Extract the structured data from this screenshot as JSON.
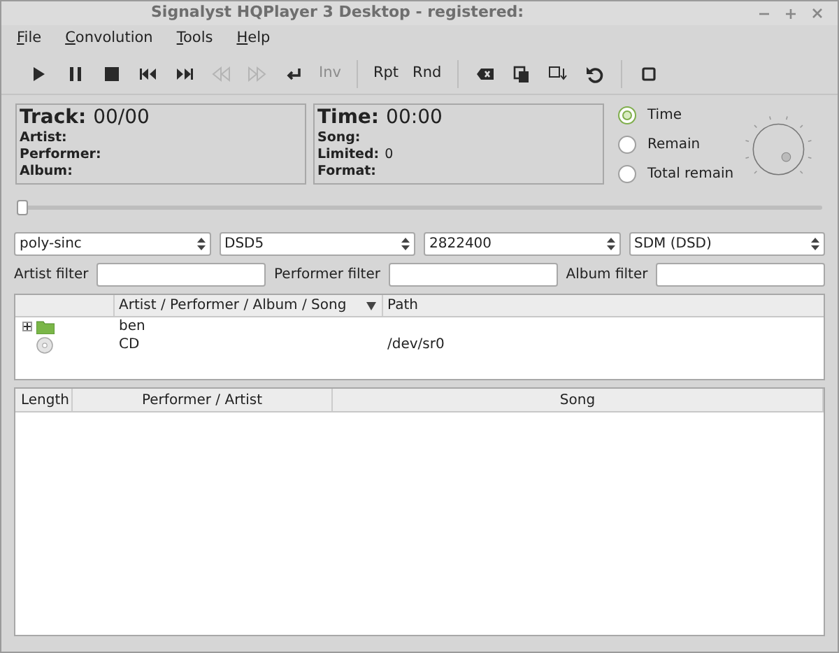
{
  "window": {
    "title": "Signalyst HQPlayer 3 Desktop - registered:"
  },
  "menu": [
    {
      "label": "File"
    },
    {
      "label": "Convolution"
    },
    {
      "label": "Tools"
    },
    {
      "label": "Help"
    }
  ],
  "toolbar": [
    {
      "kind": "icon",
      "disabled": false
    },
    {
      "kind": "icon",
      "disabled": false
    },
    {
      "kind": "icon",
      "disabled": false
    },
    {
      "kind": "icon",
      "disabled": false
    },
    {
      "kind": "icon",
      "disabled": false
    },
    {
      "kind": "icon",
      "disabled": true
    },
    {
      "kind": "icon",
      "disabled": true
    },
    {
      "kind": "icon",
      "disabled": false
    },
    {
      "kind": "text",
      "label": "Inv",
      "disabled": true
    },
    {
      "kind": "separator"
    },
    {
      "kind": "text",
      "label": "Rpt",
      "disabled": false
    },
    {
      "kind": "text",
      "label": "Rnd",
      "disabled": false
    },
    {
      "kind": "separator"
    },
    {
      "kind": "icon",
      "disabled": false
    },
    {
      "kind": "icon",
      "disabled": false
    },
    {
      "kind": "icon",
      "disabled": false
    },
    {
      "kind": "icon",
      "disabled": false
    },
    {
      "kind": "separator"
    },
    {
      "kind": "icon",
      "disabled": false
    }
  ],
  "track_panel": {
    "heading": "Track:",
    "value": "00/00",
    "fields": [
      {
        "label": "Artist:"
      },
      {
        "label": "Performer:"
      },
      {
        "label": "Album:"
      }
    ]
  },
  "time_panel": {
    "heading": "Time:",
    "value": "00:00",
    "fields": [
      {
        "label": "Song:"
      },
      {
        "label": "Limited:",
        "value": "0"
      },
      {
        "label": "Format:"
      }
    ]
  },
  "time_mode": [
    {
      "label": "Time",
      "selected": true
    },
    {
      "label": "Remain",
      "selected": false
    },
    {
      "label": "Total remain",
      "selected": false
    }
  ],
  "seek": {
    "level": 0
  },
  "selectors": [
    {
      "value": "poly-sinc"
    },
    {
      "value": "DSD5"
    },
    {
      "value": "2822400"
    },
    {
      "value": "SDM (DSD)"
    }
  ],
  "filters": [
    {
      "label": "Artist filter"
    },
    {
      "label": "Performer filter"
    },
    {
      "label": "Album filter"
    }
  ],
  "library": {
    "columns": [
      "Artist / Performer / Album / Song",
      "Path"
    ],
    "rows": [
      {
        "kind": "folder",
        "name": "ben",
        "expanded": false
      },
      {
        "kind": "disc",
        "name": "CD",
        "path": "/dev/sr0"
      }
    ]
  },
  "playlist": {
    "columns": [
      "Length",
      "Performer / Artist",
      "Song"
    ]
  }
}
